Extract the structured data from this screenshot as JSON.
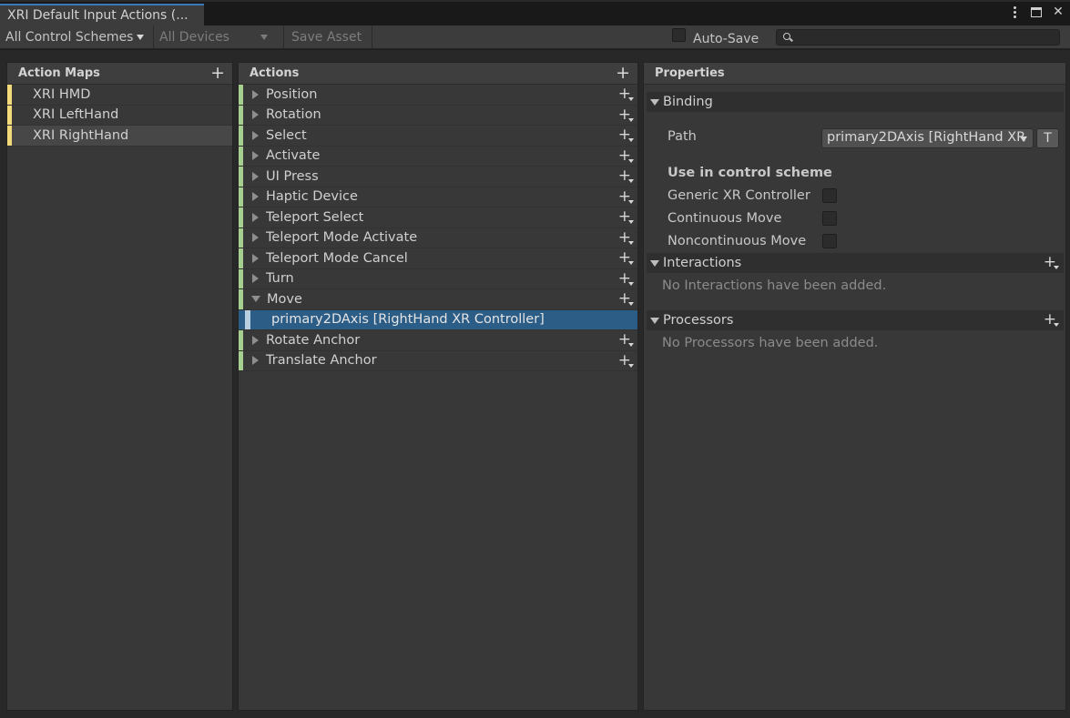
{
  "window": {
    "tab_title": "XRI Default Input Actions (..."
  },
  "toolbar": {
    "control_schemes": "All Control Schemes",
    "devices": "All Devices",
    "save_asset": "Save Asset",
    "auto_save": "Auto-Save",
    "auto_save_checked": false,
    "search_value": ""
  },
  "action_maps": {
    "header": "Action Maps",
    "items": [
      {
        "label": "XRI HMD",
        "selected": false
      },
      {
        "label": "XRI LeftHand",
        "selected": false
      },
      {
        "label": "XRI RightHand",
        "selected": true
      }
    ]
  },
  "actions": {
    "header": "Actions",
    "items": [
      {
        "label": "Position"
      },
      {
        "label": "Rotation"
      },
      {
        "label": "Select"
      },
      {
        "label": "Activate"
      },
      {
        "label": "UI Press"
      },
      {
        "label": "Haptic Device"
      },
      {
        "label": "Teleport Select"
      },
      {
        "label": "Teleport Mode Activate"
      },
      {
        "label": "Teleport Mode Cancel"
      },
      {
        "label": "Turn"
      },
      {
        "label": "Move",
        "expanded": true
      },
      {
        "label": "primary2DAxis [RightHand XR Controller]",
        "binding": true
      },
      {
        "label": "Rotate Anchor"
      },
      {
        "label": "Translate Anchor"
      }
    ]
  },
  "properties": {
    "header": "Properties",
    "binding": {
      "title": "Binding",
      "path_label": "Path",
      "path_value": "primary2DAxis [RightHand XR",
      "t_button": "T",
      "use_in_scheme": "Use in control scheme",
      "schemes": [
        {
          "label": "Generic XR Controller",
          "checked": false
        },
        {
          "label": "Continuous Move",
          "checked": false
        },
        {
          "label": "Noncontinuous Move",
          "checked": false
        }
      ]
    },
    "interactions": {
      "title": "Interactions",
      "empty": "No Interactions have been added."
    },
    "processors": {
      "title": "Processors",
      "empty": "No Processors have been added."
    }
  },
  "colors": {
    "map_accent": "#f2d97a",
    "action_accent": "#a6cf8f",
    "selection": "#2c5d87"
  }
}
